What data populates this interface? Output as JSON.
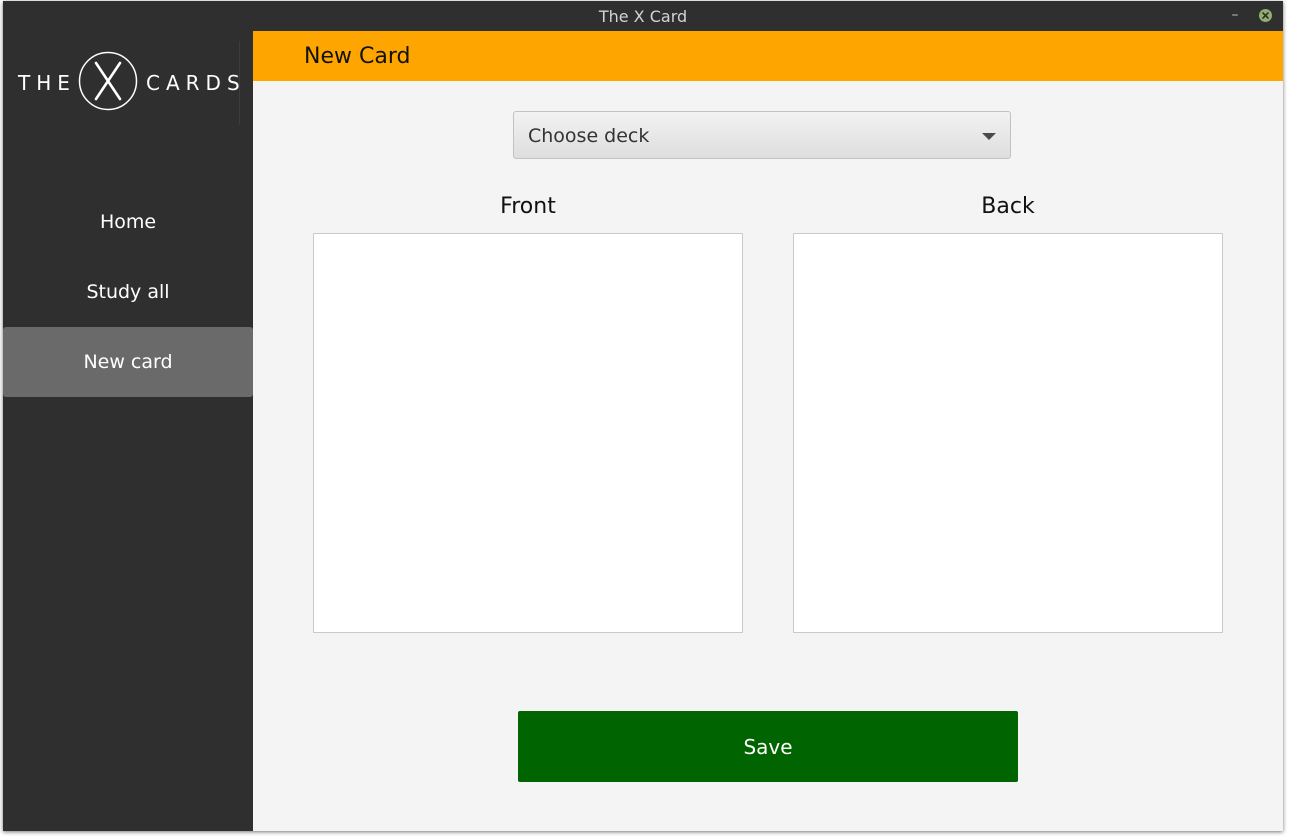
{
  "window": {
    "title": "The X Card"
  },
  "sidebar": {
    "logo": {
      "left_word": "THE",
      "middle_letter": "X",
      "right_word": "CARDS"
    },
    "items": [
      {
        "label": "Home",
        "active": false
      },
      {
        "label": "Study all",
        "active": false
      },
      {
        "label": "New card",
        "active": true
      }
    ]
  },
  "header": {
    "title": "New Card",
    "color": "#ffa500"
  },
  "form": {
    "deck_select": {
      "selected": "Choose deck"
    },
    "front_label": "Front",
    "back_label": "Back",
    "front_value": "",
    "back_value": "",
    "save_label": "Save",
    "save_color": "#006400"
  },
  "icons": {
    "minimize": "minimize-icon",
    "close": "close-icon",
    "dropdown": "chevron-down-icon"
  }
}
